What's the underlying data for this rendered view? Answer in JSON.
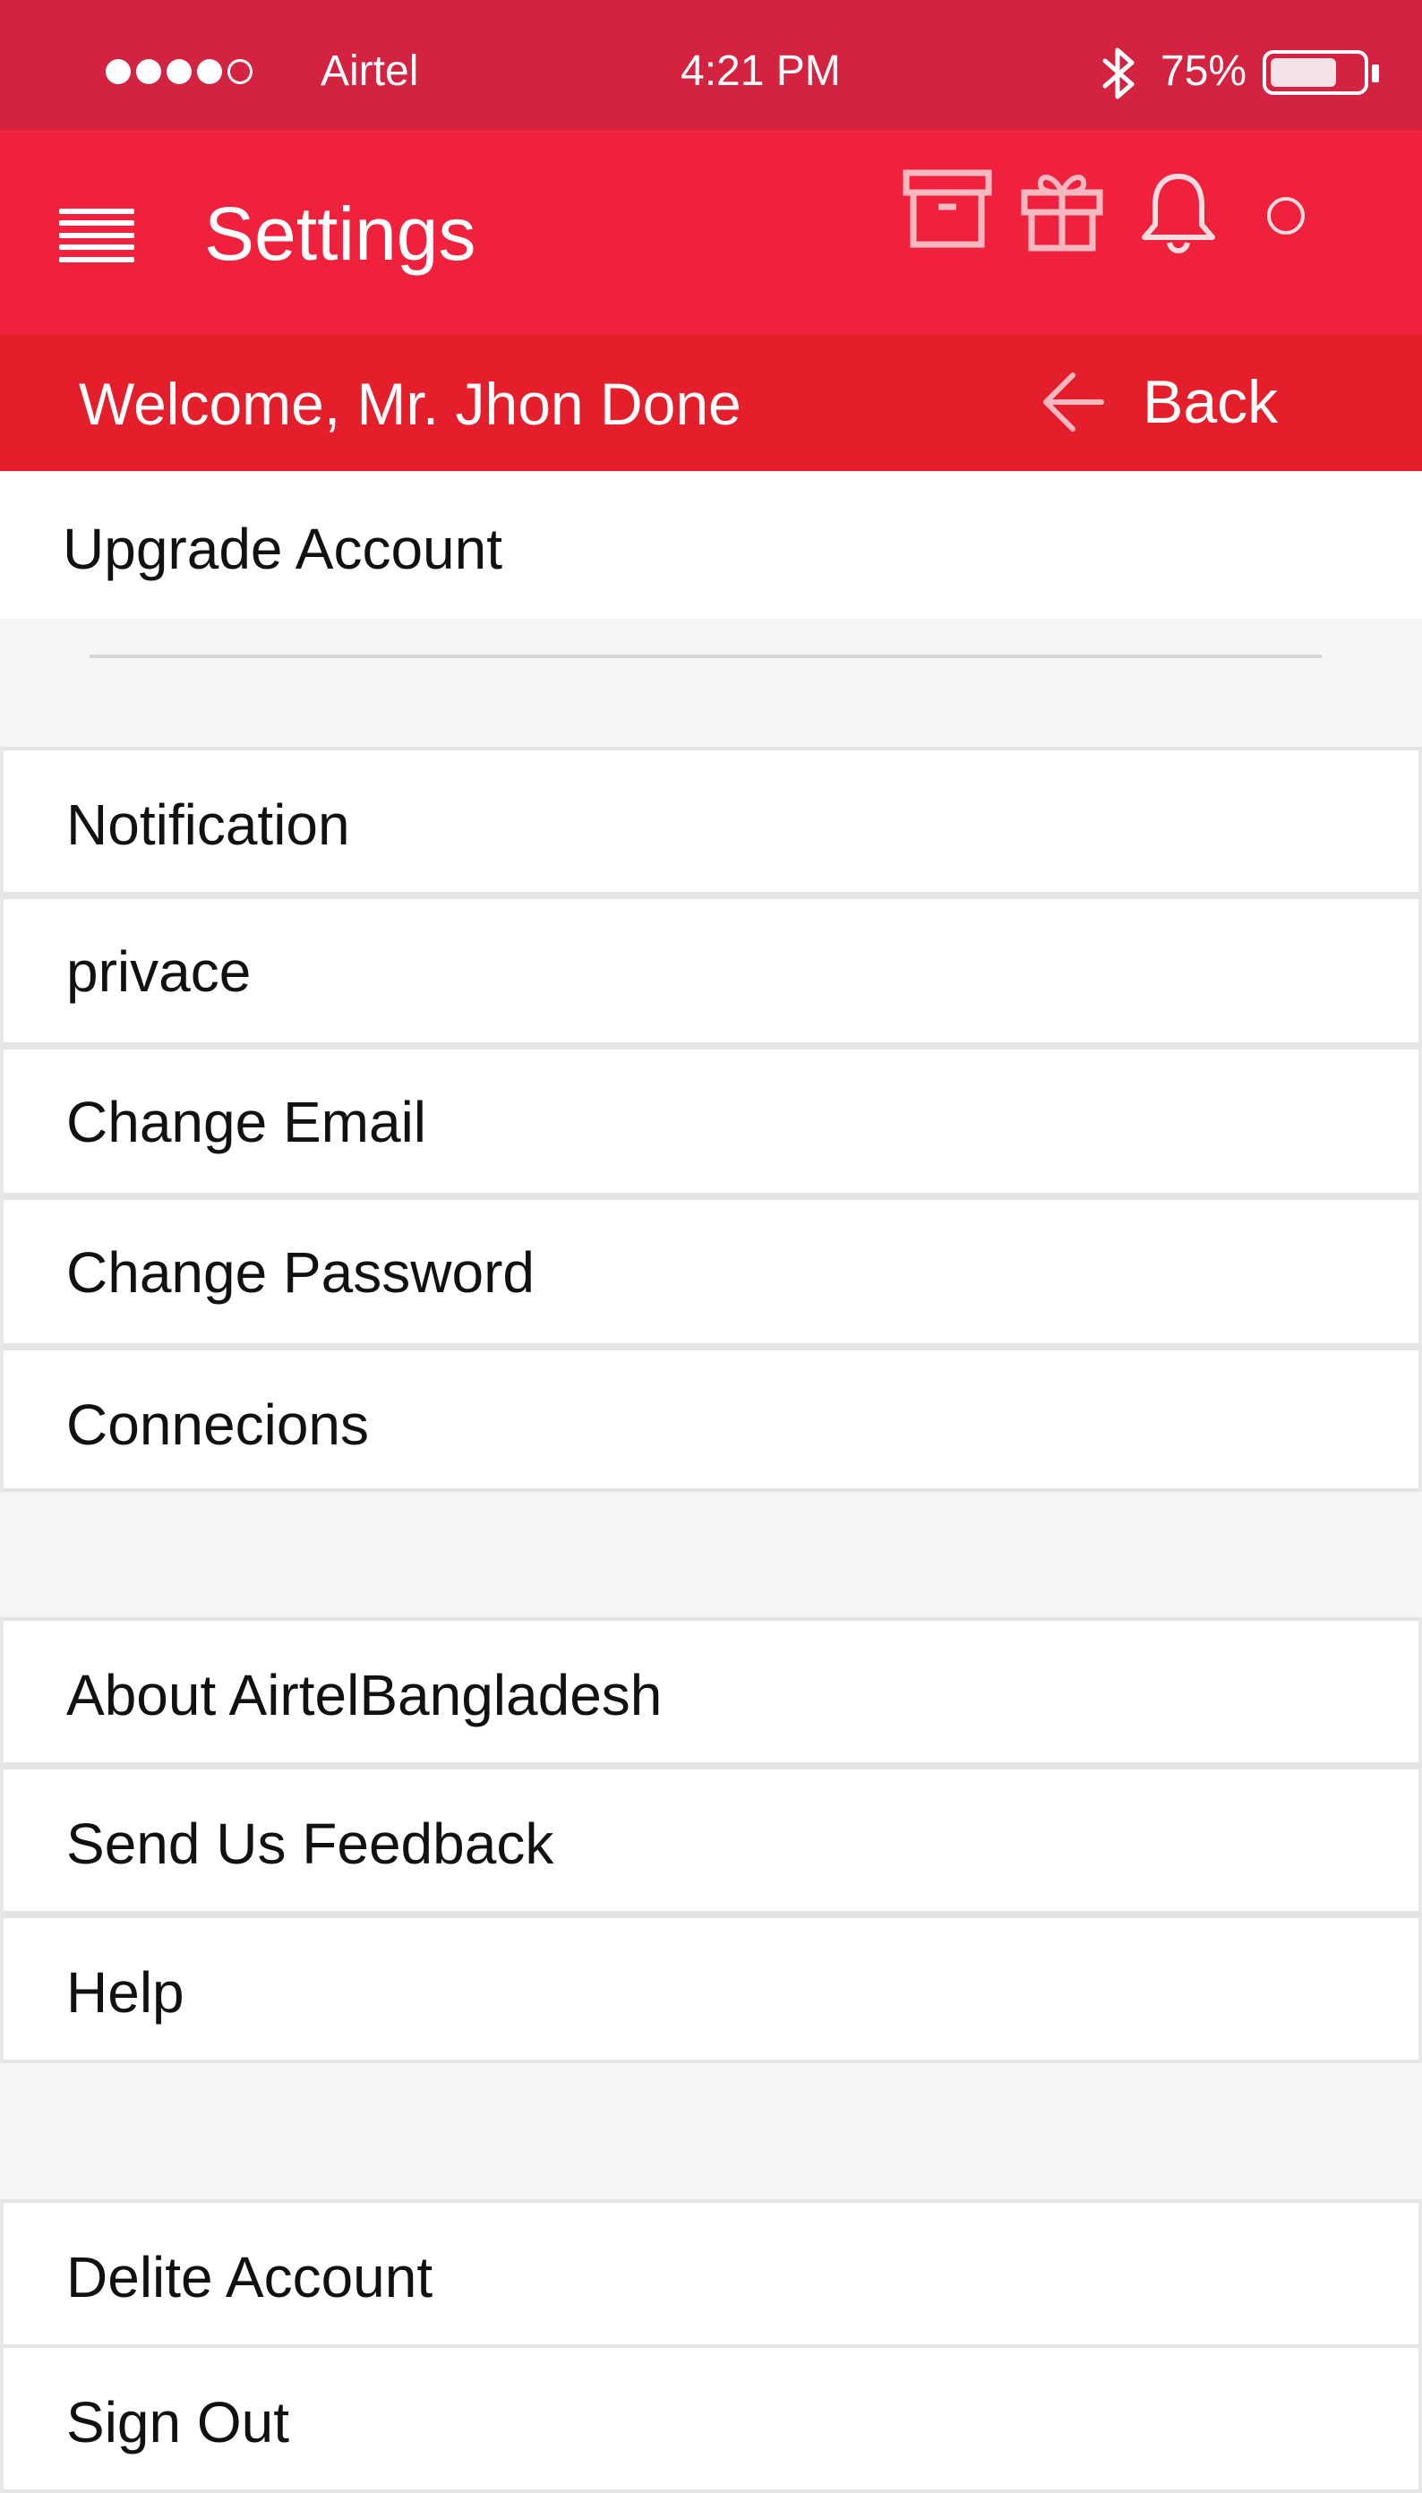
{
  "status_bar": {
    "carrier": "Airtel",
    "time": "4:21  PM",
    "battery_percent": "75%",
    "battery_level": 0.75,
    "signal_strength": 4,
    "signal_max": 5
  },
  "app_bar": {
    "title": "Settings",
    "icons": [
      "menu-icon",
      "archive-icon",
      "gift-icon",
      "bell-icon",
      "circle-icon"
    ]
  },
  "welcome_bar": {
    "welcome": "Welcome, Mr. Jhon Done",
    "back_label": "Back"
  },
  "settings": {
    "upgrade": "Upgrade Account",
    "group1": [
      "Notification",
      "privace",
      "Change Email",
      "Change Password",
      "Connecions"
    ],
    "group2": [
      "About AirtelBangladesh",
      "Send Us Feedback",
      "Help"
    ],
    "group3": [
      "Delite Account",
      "Sign Out"
    ]
  },
  "colors": {
    "status_bar": "#d42340",
    "app_bar": "#ef213d",
    "welcome_bar": "#e41e2b",
    "background": "#f5f5f5"
  }
}
